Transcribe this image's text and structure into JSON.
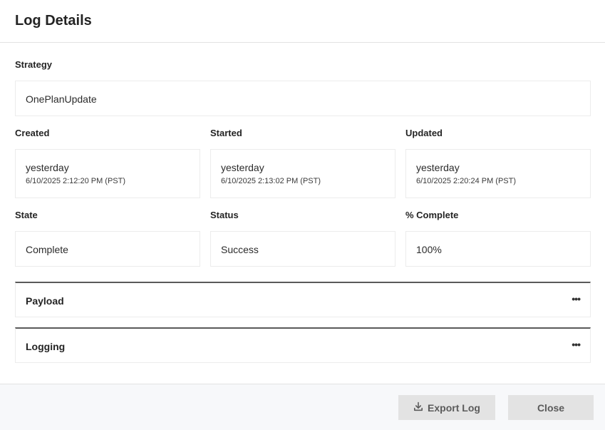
{
  "dialog": {
    "title": "Log Details"
  },
  "strategy": {
    "label": "Strategy",
    "value": "OnePlanUpdate"
  },
  "created": {
    "label": "Created",
    "relative": "yesterday",
    "timestamp": "6/10/2025 2:12:20 PM (PST)"
  },
  "started": {
    "label": "Started",
    "relative": "yesterday",
    "timestamp": "6/10/2025 2:13:02 PM (PST)"
  },
  "updated": {
    "label": "Updated",
    "relative": "yesterday",
    "timestamp": "6/10/2025 2:20:24 PM (PST)"
  },
  "state": {
    "label": "State",
    "value": "Complete"
  },
  "status": {
    "label": "Status",
    "value": "Success"
  },
  "percent": {
    "label": "% Complete",
    "value": "100%"
  },
  "sections": [
    {
      "title": "Payload",
      "icon": "more-icon"
    },
    {
      "title": "Logging",
      "icon": "more-icon"
    }
  ],
  "footer": {
    "export_label": "Export Log",
    "export_icon": "download-icon",
    "close_label": "Close"
  }
}
